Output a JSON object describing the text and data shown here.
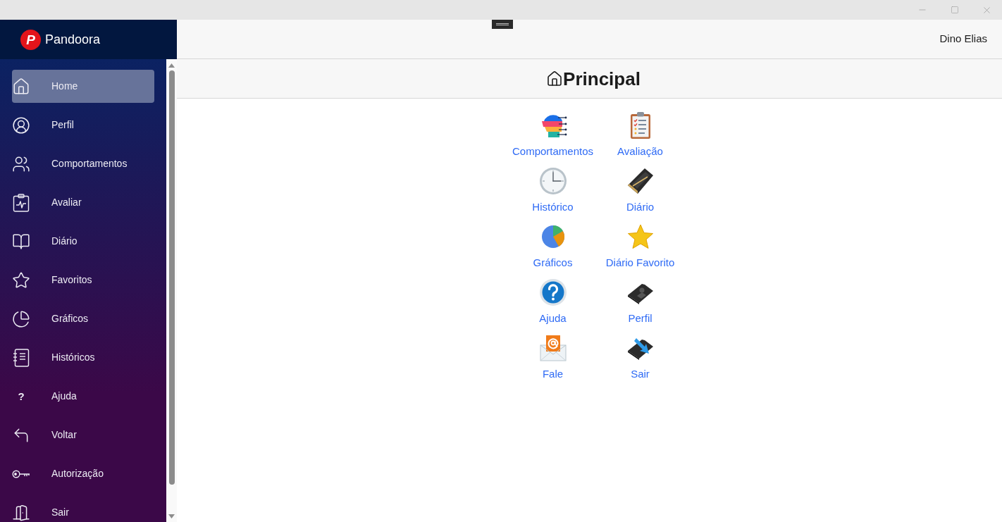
{
  "sidebar": {
    "brand": {
      "logo_letter": "P",
      "name": "Pandoora"
    },
    "items": [
      {
        "label": "Home",
        "selected": true
      },
      {
        "label": "Perfil",
        "selected": false
      },
      {
        "label": "Comportamentos",
        "selected": false
      },
      {
        "label": "Avaliar",
        "selected": false
      },
      {
        "label": "Diário",
        "selected": false
      },
      {
        "label": "Favoritos",
        "selected": false
      },
      {
        "label": "Gráficos",
        "selected": false
      },
      {
        "label": "Históricos",
        "selected": false
      },
      {
        "label": "Ajuda",
        "glyph": "?",
        "selected": false
      },
      {
        "label": "Voltar",
        "selected": false
      },
      {
        "label": "Autorização",
        "selected": false
      },
      {
        "label": "Sair",
        "selected": false
      }
    ]
  },
  "header": {
    "user": "Dino Elias"
  },
  "page": {
    "title": "Principal",
    "tiles": [
      {
        "label": "Comportamentos"
      },
      {
        "label": "Avaliação"
      },
      {
        "label": "Histórico"
      },
      {
        "label": "Diário"
      },
      {
        "label": "Gráficos"
      },
      {
        "label": "Diário Favorito"
      },
      {
        "label": "Ajuda"
      },
      {
        "label": "Perfil"
      },
      {
        "label": "Fale"
      },
      {
        "label": "Sair"
      }
    ]
  }
}
